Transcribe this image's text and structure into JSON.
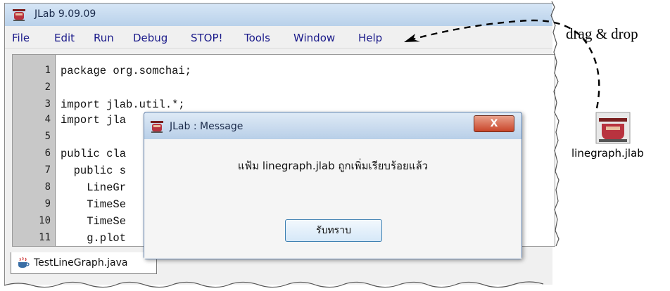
{
  "window": {
    "title": "JLab 9.09.09"
  },
  "menu": [
    "File",
    "Edit",
    "Run",
    "Debug",
    "STOP!",
    "Tools",
    "Window",
    "Help"
  ],
  "editor": {
    "line_numbers": [
      "1",
      "2",
      "3",
      "4",
      "5",
      "6",
      "7",
      "8",
      "9",
      "10",
      "11"
    ],
    "lines": [
      "package org.somchai;",
      "",
      "import jlab.util.*;",
      "import jla",
      "",
      "public cla",
      "  public s",
      "    LineGr",
      "    TimeSe",
      "    TimeSe",
      "    g.plot"
    ]
  },
  "tab": {
    "label": "TestLineGraph.java"
  },
  "dialog": {
    "title": "JLab : Message",
    "close_label": "X",
    "message": "แฟ้ม linegraph.jlab ถูกเพิ่มเรียบร้อยแล้ว",
    "ok_label": "รับทราบ"
  },
  "annotation": {
    "drag_label": "drag & drop",
    "file_label": "linegraph.jlab"
  },
  "colors": {
    "menu_text": "#1a1a8a",
    "gutter": "#c8c8c8",
    "close_red": "#c9452a"
  }
}
